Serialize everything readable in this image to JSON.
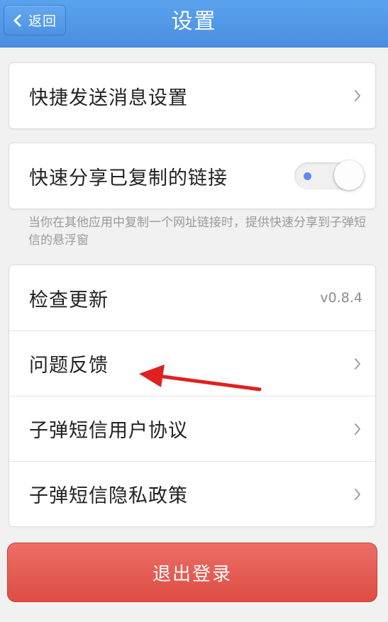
{
  "header": {
    "back_label": "返回",
    "title": "设置"
  },
  "quick_send": {
    "label": "快捷发送消息设置"
  },
  "quick_share": {
    "label": "快速分享已复制的链接",
    "toggle_on": true,
    "hint": "当你在其他应用中复制一个网址链接时，提供快速分享到子弹短信的悬浮窗"
  },
  "info_list": {
    "items": [
      {
        "label": "检查更新",
        "value": "v0.8.4"
      },
      {
        "label": "问题反馈"
      },
      {
        "label": "子弹短信用户协议"
      },
      {
        "label": "子弹短信隐私政策"
      }
    ]
  },
  "logout": {
    "label": "退出登录"
  },
  "colors": {
    "header": "#4a8fe0",
    "logout": "#e35a50",
    "annotation_arrow": "#e02020"
  }
}
